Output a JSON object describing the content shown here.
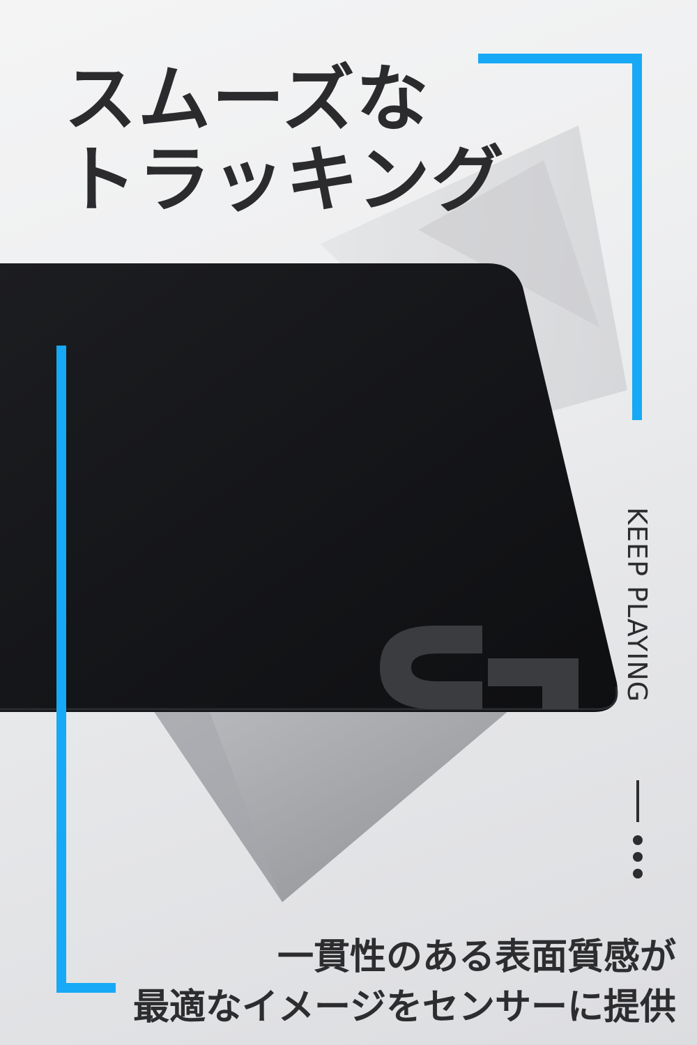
{
  "headline": {
    "line1": "スムーズな",
    "line2": "トラッキング"
  },
  "tagline": "KEEP PLAYING",
  "caption": {
    "line1": "一貫性のある表面質感が",
    "line2": "最適なイメージをセンサーに提供"
  },
  "colors": {
    "accent": "#17a9f5",
    "pad": "#16171a",
    "logo": "#3b3c40",
    "text": "#2b2b2d"
  },
  "icons": {
    "logo": "logitech-g-logo",
    "decor": "decorative-dash-and-dots"
  }
}
